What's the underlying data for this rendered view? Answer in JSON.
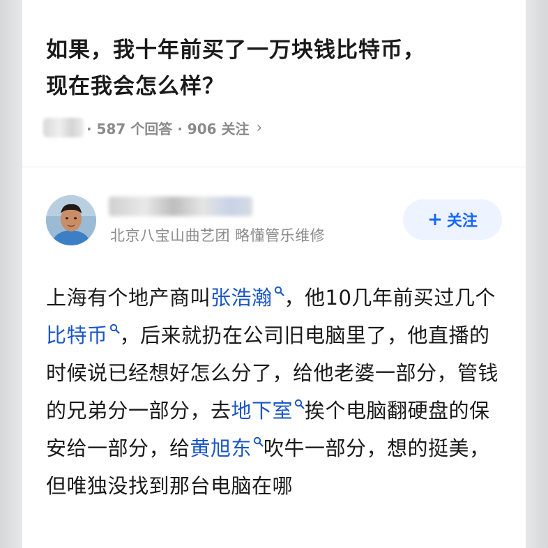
{
  "question": {
    "title_line1": "如果，我十年前买了一万块钱比特币，",
    "title_line2": "现在我会怎么样？",
    "meta": "· 587 个回答 · 906 关注",
    "chevron": "›"
  },
  "author": {
    "bio": "北京八宝山曲艺团 略懂管乐维修",
    "follow_plus": "+",
    "follow_label": "关注"
  },
  "answer": {
    "t1": "上海有个地产商叫",
    "link1": "张浩瀚",
    "t2": "，他10几年前买过几个",
    "link2": "比特币",
    "t3": "，后来就扔在公司旧电脑里了，他直播的时候说已经想好怎么分了，给他老婆一部分，管钱的兄弟分一部分，去",
    "link3": "地下室",
    "t4": "挨个电脑翻硬盘的保安给一部分，给",
    "link4": "黄旭东",
    "t5": "吹牛一部分，想的挺美，但唯独没找到那台电脑在哪"
  },
  "colors": {
    "link": "#1a56c8",
    "accent": "#1766ff",
    "follow_bg": "#eef4ff",
    "meta": "#8a8a8a"
  },
  "icons": [
    "search-icon",
    "chevron-right-icon",
    "plus-icon"
  ]
}
